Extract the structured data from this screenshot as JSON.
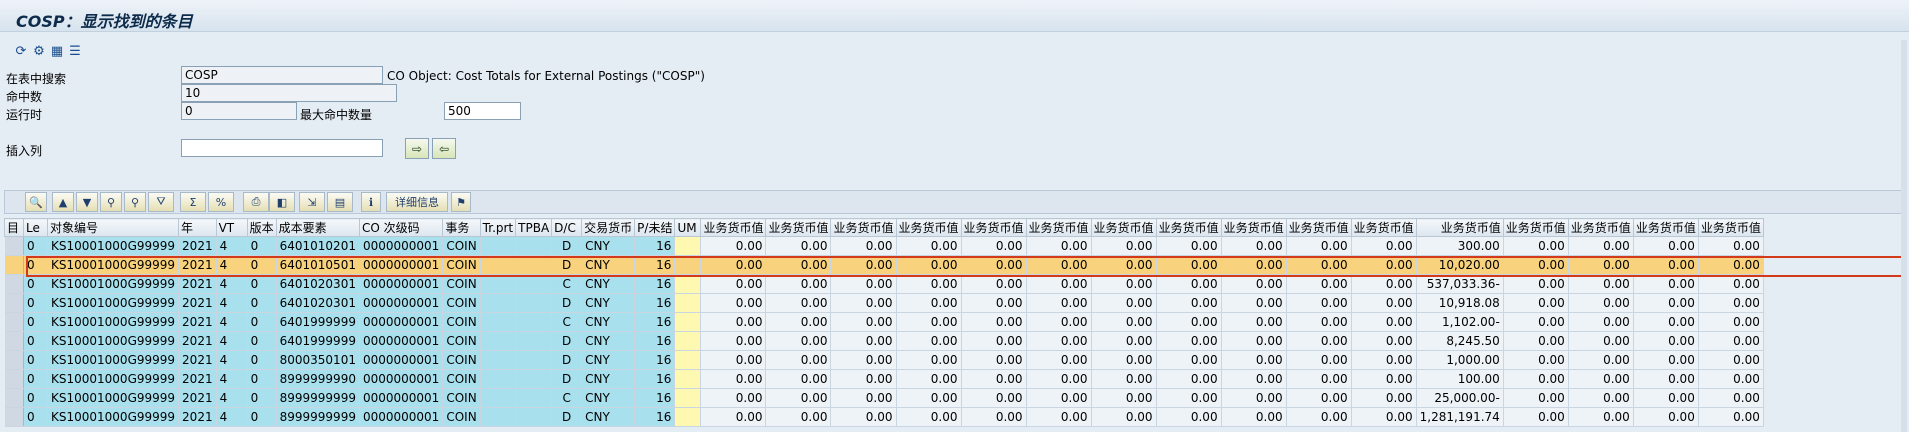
{
  "window": {
    "title": "COSP：显示找到的条目"
  },
  "toolbar_icons": [
    "refresh-icon",
    "settings-icon",
    "config-icon",
    "list-icon"
  ],
  "search": {
    "table_label": "在表中搜索",
    "table_value": "COSP",
    "table_desc": "CO Object: Cost Totals for External Postings (\"COSP\")",
    "hits_label": "命中数",
    "hits_value": "10",
    "runtime_label": "运行时",
    "runtime_value": "0",
    "max_hits_label": "最大命中数量",
    "max_hits_value": "500",
    "insert_col_label": "插入列",
    "insert_col_value": ""
  },
  "alv_toolbar": {
    "details_label": "详细信息"
  },
  "grid": {
    "headers": [
      "",
      "Le",
      "对象编号",
      "年",
      "VT",
      "版本",
      "成本要素",
      "CO 次级码",
      "事务",
      "Tr.prt",
      "TPBA",
      "D/C",
      "交易货币",
      "P/未结",
      "UM",
      "业务货币值",
      "业务货币值",
      "业务货币值",
      "业务货币值",
      "业务货币值",
      "业务货币值",
      "业务货币值",
      "业务货币值",
      "业务货币值",
      "业务货币值",
      "业务货币值",
      "业务货币值",
      "业务货币值",
      "业务货币值",
      "业务货币值",
      "业务货币值"
    ],
    "sel_header": "目",
    "rows": [
      {
        "le": "0",
        "obj": "KS10001000G99999",
        "year": "2021",
        "vt": "4",
        "ver": "0",
        "ce": "6401010201",
        "co": "0000000001",
        "tx": "COIN",
        "trprt": "",
        "tpba": "",
        "dc": "D",
        "cur": "CNY",
        "p": "16",
        "um": "",
        "vals": [
          "0.00",
          "0.00",
          "0.00",
          "0.00",
          "0.00",
          "0.00",
          "0.00",
          "0.00",
          "0.00",
          "0.00",
          "0.00",
          "300.00",
          "0.00",
          "0.00",
          "0.00",
          "0.00"
        ]
      },
      {
        "le": "0",
        "obj": "KS10001000G99999",
        "year": "2021",
        "vt": "4",
        "ver": "0",
        "ce": "6401010501",
        "co": "0000000001",
        "tx": "COIN",
        "trprt": "",
        "tpba": "",
        "dc": "D",
        "cur": "CNY",
        "p": "16",
        "um": "",
        "vals": [
          "0.00",
          "0.00",
          "0.00",
          "0.00",
          "0.00",
          "0.00",
          "0.00",
          "0.00",
          "0.00",
          "0.00",
          "0.00",
          "10,020.00",
          "0.00",
          "0.00",
          "0.00",
          "0.00"
        ]
      },
      {
        "le": "0",
        "obj": "KS10001000G99999",
        "year": "2021",
        "vt": "4",
        "ver": "0",
        "ce": "6401020301",
        "co": "0000000001",
        "tx": "COIN",
        "trprt": "",
        "tpba": "",
        "dc": "C",
        "cur": "CNY",
        "p": "16",
        "um": "",
        "vals": [
          "0.00",
          "0.00",
          "0.00",
          "0.00",
          "0.00",
          "0.00",
          "0.00",
          "0.00",
          "0.00",
          "0.00",
          "0.00",
          "537,033.36-",
          "0.00",
          "0.00",
          "0.00",
          "0.00"
        ]
      },
      {
        "le": "0",
        "obj": "KS10001000G99999",
        "year": "2021",
        "vt": "4",
        "ver": "0",
        "ce": "6401020301",
        "co": "0000000001",
        "tx": "COIN",
        "trprt": "",
        "tpba": "",
        "dc": "D",
        "cur": "CNY",
        "p": "16",
        "um": "",
        "vals": [
          "0.00",
          "0.00",
          "0.00",
          "0.00",
          "0.00",
          "0.00",
          "0.00",
          "0.00",
          "0.00",
          "0.00",
          "0.00",
          "10,918.08",
          "0.00",
          "0.00",
          "0.00",
          "0.00"
        ]
      },
      {
        "le": "0",
        "obj": "KS10001000G99999",
        "year": "2021",
        "vt": "4",
        "ver": "0",
        "ce": "6401999999",
        "co": "0000000001",
        "tx": "COIN",
        "trprt": "",
        "tpba": "",
        "dc": "C",
        "cur": "CNY",
        "p": "16",
        "um": "",
        "vals": [
          "0.00",
          "0.00",
          "0.00",
          "0.00",
          "0.00",
          "0.00",
          "0.00",
          "0.00",
          "0.00",
          "0.00",
          "0.00",
          "1,102.00-",
          "0.00",
          "0.00",
          "0.00",
          "0.00"
        ]
      },
      {
        "le": "0",
        "obj": "KS10001000G99999",
        "year": "2021",
        "vt": "4",
        "ver": "0",
        "ce": "6401999999",
        "co": "0000000001",
        "tx": "COIN",
        "trprt": "",
        "tpba": "",
        "dc": "D",
        "cur": "CNY",
        "p": "16",
        "um": "",
        "vals": [
          "0.00",
          "0.00",
          "0.00",
          "0.00",
          "0.00",
          "0.00",
          "0.00",
          "0.00",
          "0.00",
          "0.00",
          "0.00",
          "8,245.50",
          "0.00",
          "0.00",
          "0.00",
          "0.00"
        ]
      },
      {
        "le": "0",
        "obj": "KS10001000G99999",
        "year": "2021",
        "vt": "4",
        "ver": "0",
        "ce": "8000350101",
        "co": "0000000001",
        "tx": "COIN",
        "trprt": "",
        "tpba": "",
        "dc": "D",
        "cur": "CNY",
        "p": "16",
        "um": "",
        "vals": [
          "0.00",
          "0.00",
          "0.00",
          "0.00",
          "0.00",
          "0.00",
          "0.00",
          "0.00",
          "0.00",
          "0.00",
          "0.00",
          "1,000.00",
          "0.00",
          "0.00",
          "0.00",
          "0.00"
        ]
      },
      {
        "le": "0",
        "obj": "KS10001000G99999",
        "year": "2021",
        "vt": "4",
        "ver": "0",
        "ce": "8999999990",
        "co": "0000000001",
        "tx": "COIN",
        "trprt": "",
        "tpba": "",
        "dc": "D",
        "cur": "CNY",
        "p": "16",
        "um": "",
        "vals": [
          "0.00",
          "0.00",
          "0.00",
          "0.00",
          "0.00",
          "0.00",
          "0.00",
          "0.00",
          "0.00",
          "0.00",
          "0.00",
          "100.00",
          "0.00",
          "0.00",
          "0.00",
          "0.00"
        ]
      },
      {
        "le": "0",
        "obj": "KS10001000G99999",
        "year": "2021",
        "vt": "4",
        "ver": "0",
        "ce": "8999999999",
        "co": "0000000001",
        "tx": "COIN",
        "trprt": "",
        "tpba": "",
        "dc": "C",
        "cur": "CNY",
        "p": "16",
        "um": "",
        "vals": [
          "0.00",
          "0.00",
          "0.00",
          "0.00",
          "0.00",
          "0.00",
          "0.00",
          "0.00",
          "0.00",
          "0.00",
          "0.00",
          "25,000.00-",
          "0.00",
          "0.00",
          "0.00",
          "0.00"
        ]
      },
      {
        "le": "0",
        "obj": "KS10001000G99999",
        "year": "2021",
        "vt": "4",
        "ver": "0",
        "ce": "8999999999",
        "co": "0000000001",
        "tx": "COIN",
        "trprt": "",
        "tpba": "",
        "dc": "D",
        "cur": "CNY",
        "p": "16",
        "um": "",
        "vals": [
          "0.00",
          "0.00",
          "0.00",
          "0.00",
          "0.00",
          "0.00",
          "0.00",
          "0.00",
          "0.00",
          "0.00",
          "0.00",
          "1,281,191.74",
          "0.00",
          "0.00",
          "0.00",
          "0.00"
        ]
      }
    ],
    "highlighted_row": 1
  },
  "colors": {
    "key_column": "#a8e0ee",
    "um_column": "#fff8b0",
    "highlight_row": "#f8d27c",
    "highlight_frame": "#d23a1a"
  }
}
